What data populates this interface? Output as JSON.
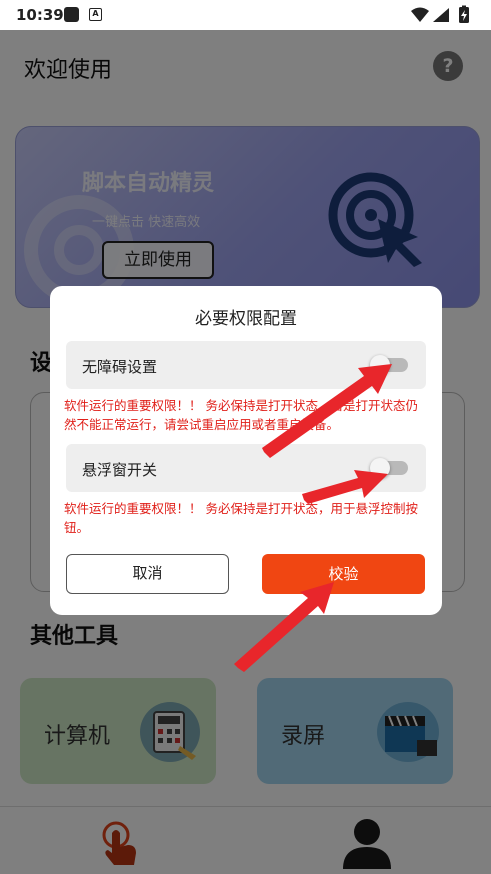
{
  "status_bar": {
    "time": "10:39",
    "icons": [
      "notification-square-icon",
      "a-badge-icon",
      "wifi-icon",
      "signal-icon",
      "battery-charging-icon"
    ]
  },
  "header": {
    "title": "欢迎使用",
    "help_icon": "?"
  },
  "banner": {
    "title": "脚本自动精灵",
    "subtitle": "一键点击 快速高效",
    "button_label": "立即使用"
  },
  "sections": {
    "settings_partial": "设",
    "other_tools": "其他工具"
  },
  "tools": [
    {
      "label": "计算机",
      "icon": "calculator-icon",
      "color": "#cfe9c7"
    },
    {
      "label": "录屏",
      "icon": "screen-record-icon",
      "color": "#a3d4ee"
    }
  ],
  "bottom_nav": [
    {
      "icon": "tap-hand-icon",
      "active": true
    },
    {
      "icon": "user-icon",
      "active": false
    }
  ],
  "dialog": {
    "title": "必要权限配置",
    "permissions": [
      {
        "label": "无障碍设置",
        "enabled": false,
        "note": "软件运行的重要权限！！ 务必保持是打开状态，若是打开状态仍然不能正常运行，请尝试重启应用或者重启设备。"
      },
      {
        "label": "悬浮窗开关",
        "enabled": false,
        "note": "软件运行的重要权限！！ 务必保持是打开状态，用于悬浮控制按钮。"
      }
    ],
    "cancel_label": "取消",
    "verify_label": "校验"
  },
  "colors": {
    "accent": "#f04612",
    "warning_text": "#e0201a",
    "annotation_arrow": "#e8262b"
  }
}
